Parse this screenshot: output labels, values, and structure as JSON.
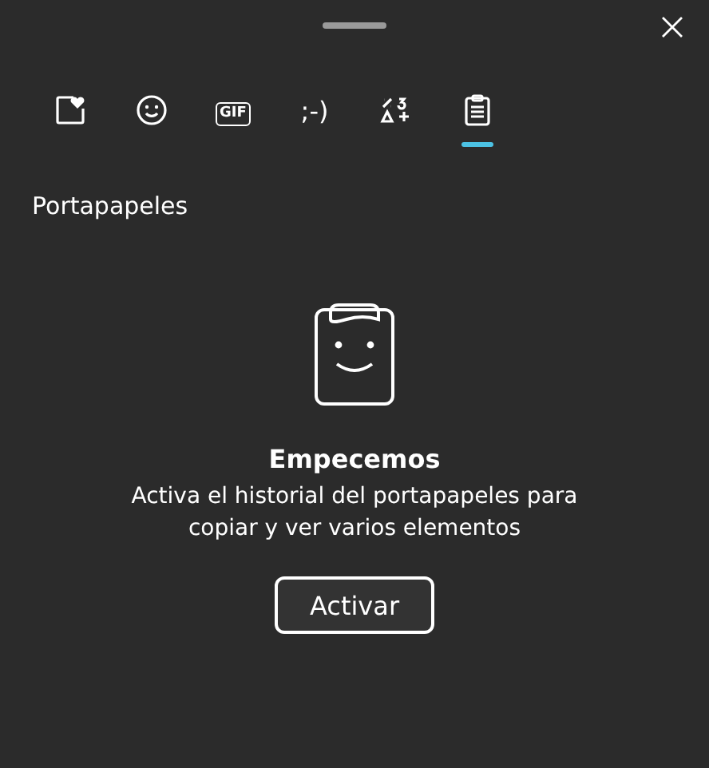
{
  "tabs": [
    {
      "kind": "favorites",
      "selected": false
    },
    {
      "kind": "emoji",
      "selected": false
    },
    {
      "kind": "gif",
      "label": "GIF",
      "selected": false
    },
    {
      "kind": "kaomoji",
      "label": ";-)",
      "selected": false
    },
    {
      "kind": "symbols",
      "selected": false
    },
    {
      "kind": "clipboard",
      "selected": true
    }
  ],
  "section_title": "Portapapeles",
  "empty_state": {
    "title": "Empecemos",
    "description": "Activa el historial del portapapeles para copiar y ver varios elementos",
    "button": "Activar"
  }
}
